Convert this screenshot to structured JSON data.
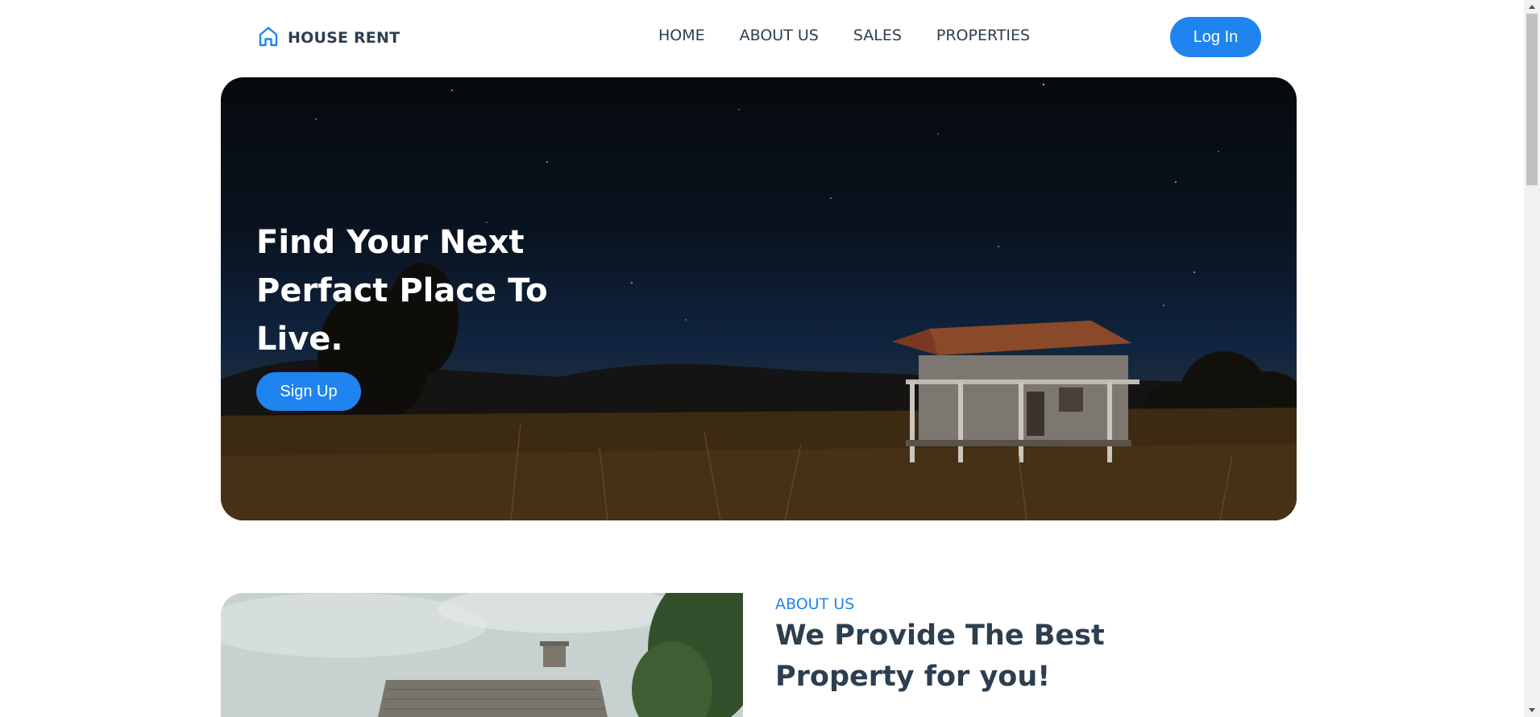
{
  "brand": {
    "name": "HOUSE RENT",
    "icon": "home-icon",
    "accent": "#1f84ef"
  },
  "nav": {
    "items": [
      {
        "label": "HOME"
      },
      {
        "label": "ABOUT US"
      },
      {
        "label": "SALES"
      },
      {
        "label": "PROPERTIES"
      }
    ],
    "login_label": "Log In"
  },
  "hero": {
    "title": "Find Your Next Perfact Place To Live.",
    "signup_label": "Sign Up"
  },
  "about": {
    "label": "ABOUT US",
    "title": "We Provide The Best Property for you!"
  },
  "colors": {
    "text": "#2d3e50",
    "primary": "#1f84ef"
  }
}
